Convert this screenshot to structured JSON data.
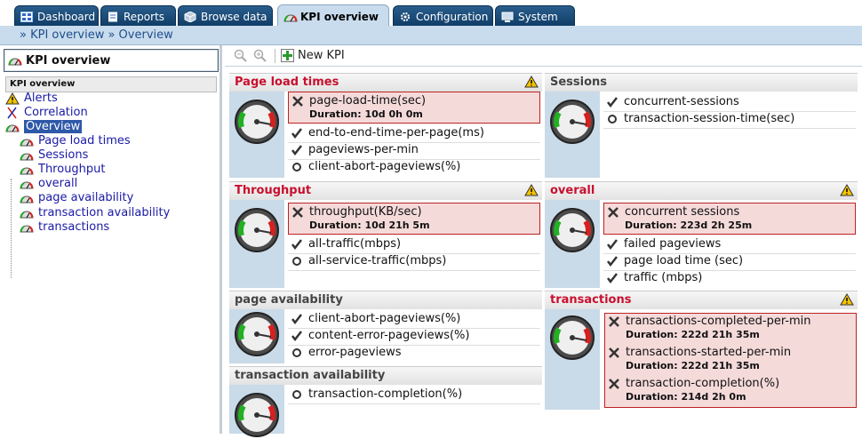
{
  "tabs": [
    {
      "label": "Dashboard",
      "icon": "dashboard-icon"
    },
    {
      "label": "Reports",
      "icon": "reports-icon"
    },
    {
      "label": "Browse data",
      "icon": "cube-icon"
    },
    {
      "label": "KPI overview",
      "icon": "gauge-icon",
      "active": true
    },
    {
      "label": "Configuration",
      "icon": "gear-icon"
    },
    {
      "label": "System",
      "icon": "monitor-icon"
    }
  ],
  "breadcrumb": {
    "text": "» KPI overview » Overview"
  },
  "left": {
    "title": "KPI overview",
    "tree_header": "KPI overview",
    "items": [
      {
        "label": "Alerts",
        "icon": "warning-icon"
      },
      {
        "label": "Correlation",
        "icon": "correlation-icon"
      },
      {
        "label": "Overview",
        "icon": "gauge-icon"
      },
      {
        "label": "Page load times",
        "icon": "gauge-icon"
      },
      {
        "label": "Sessions",
        "icon": "gauge-icon"
      },
      {
        "label": "Throughput",
        "icon": "gauge-icon"
      },
      {
        "label": "overall",
        "icon": "gauge-icon"
      },
      {
        "label": "page availability",
        "icon": "gauge-icon"
      },
      {
        "label": "transaction availability",
        "icon": "gauge-icon"
      },
      {
        "label": "transactions",
        "icon": "gauge-icon"
      }
    ]
  },
  "toolbar": {
    "new_kpi": "New KPI"
  },
  "panels": {
    "page_load": {
      "title": "Page load times",
      "items": [
        {
          "label": "page-load-time(sec)",
          "duration": "Duration: 10d 0h 0m",
          "status": "fail"
        },
        {
          "label": "end-to-end-time-per-page(ms)",
          "status": "ok"
        },
        {
          "label": "pageviews-per-min",
          "status": "ok"
        },
        {
          "label": "client-abort-pageviews(%)",
          "status": "none"
        }
      ]
    },
    "sessions": {
      "title": "Sessions",
      "items": [
        {
          "label": "concurrent-sessions",
          "status": "ok"
        },
        {
          "label": "transaction-session-time(sec)",
          "status": "none"
        }
      ]
    },
    "throughput": {
      "title": "Throughput",
      "items": [
        {
          "label": "throughput(KB/sec)",
          "duration": "Duration: 10d 21h 5m",
          "status": "fail"
        },
        {
          "label": "all-traffic(mbps)",
          "status": "ok"
        },
        {
          "label": "all-service-traffic(mbps)",
          "status": "none"
        }
      ]
    },
    "overall": {
      "title": "overall",
      "items": [
        {
          "label": "concurrent sessions",
          "duration": "Duration: 223d 2h 25m",
          "status": "fail"
        },
        {
          "label": "failed pageviews",
          "status": "ok"
        },
        {
          "label": "page load time (sec)",
          "status": "ok"
        },
        {
          "label": "traffic (mbps)",
          "status": "ok"
        }
      ]
    },
    "page_avail": {
      "title": "page availability",
      "items": [
        {
          "label": "client-abort-pageviews(%)",
          "status": "ok"
        },
        {
          "label": "content-error-pageviews(%)",
          "status": "ok"
        },
        {
          "label": "error-pageviews",
          "status": "none"
        }
      ]
    },
    "transactions": {
      "title": "transactions",
      "items": [
        {
          "label": "transactions-completed-per-min",
          "duration": "Duration: 222d 21h 35m",
          "status": "fail"
        },
        {
          "label": "transactions-started-per-min",
          "duration": "Duration: 222d 21h 35m",
          "status": "fail"
        },
        {
          "label": "transaction-completion(%)",
          "duration": "Duration: 214d 2h 0m",
          "status": "fail"
        }
      ]
    },
    "trans_avail": {
      "title": "transaction availability",
      "items": [
        {
          "label": "transaction-completion(%)",
          "status": "none"
        }
      ]
    }
  },
  "colors": {
    "accent": "#c8102e",
    "tab": "#1a4b78",
    "breadcrumb_bg": "#c9dced"
  }
}
